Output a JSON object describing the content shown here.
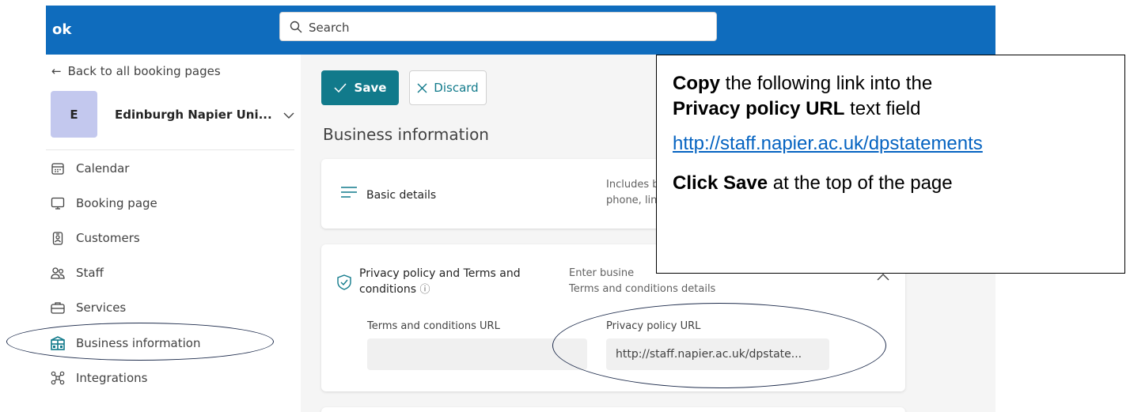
{
  "app": {
    "brand": "ok",
    "search_placeholder": "Search"
  },
  "sidebar": {
    "back_label": "Back to all booking pages",
    "business": {
      "initial": "E",
      "name": "Edinburgh Napier Uni..."
    },
    "items": [
      {
        "label": "Calendar",
        "icon": "calendar-icon"
      },
      {
        "label": "Booking page",
        "icon": "monitor-icon"
      },
      {
        "label": "Customers",
        "icon": "badge-icon"
      },
      {
        "label": "Staff",
        "icon": "people-icon"
      },
      {
        "label": "Services",
        "icon": "briefcase-icon"
      },
      {
        "label": "Business information",
        "icon": "building-icon",
        "selected": true
      },
      {
        "label": "Integrations",
        "icon": "integrations-icon"
      }
    ]
  },
  "toolbar": {
    "save_label": "Save",
    "discard_label": "Discard"
  },
  "main": {
    "title": "Business information",
    "basic": {
      "label": "Basic details",
      "description_line1": "Includes bu",
      "description_line2": "phone, links"
    },
    "privacy": {
      "label_line1": "Privacy policy and Terms and",
      "label_line2": "conditions",
      "description_line1": "Enter busine",
      "description_line2": "Terms and conditions details",
      "terms_label": "Terms and conditions URL",
      "terms_value": "",
      "privacy_label": "Privacy policy URL",
      "privacy_value": "http://staff.napier.ac.uk/dpstate..."
    }
  },
  "instructions": {
    "line1_bold": "Copy",
    "line1_rest": " the following link into the",
    "line2_bold": "Privacy policy URL",
    "line2_rest": " text field",
    "link": "http://staff.napier.ac.uk/dpstatements",
    "line3_bold": "Click Save",
    "line3_rest": " at the top of the page"
  },
  "colors": {
    "topbar": "#0f6cbd",
    "accent": "#117a8b",
    "avatar": "#c3c8ee",
    "link": "#0563c1"
  }
}
